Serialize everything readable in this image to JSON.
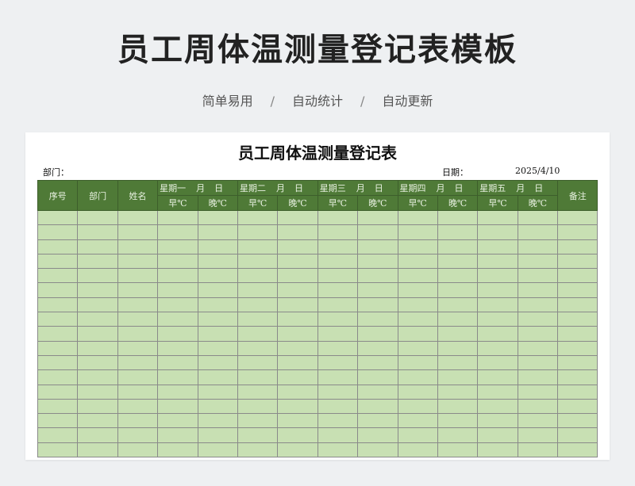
{
  "page": {
    "title": "员工周体温测量登记表模板",
    "features": [
      "简单易用",
      "自动统计",
      "自动更新"
    ],
    "separator": "/"
  },
  "sheet": {
    "title": "员工周体温测量登记表",
    "department_label": "部门：",
    "date_label": "日期：",
    "date_value": "2025/4/10",
    "headers": {
      "index": "序号",
      "department": "部门",
      "name": "姓名",
      "remark": "备注",
      "month": "月",
      "day": "日",
      "morning": "早℃",
      "evening": "晚℃",
      "weekdays": [
        "星期一",
        "星期二",
        "星期三",
        "星期四",
        "星期五"
      ]
    },
    "header_color": "#4f7a37",
    "cell_color": "#c8e0b3",
    "empty_rows": 17
  }
}
